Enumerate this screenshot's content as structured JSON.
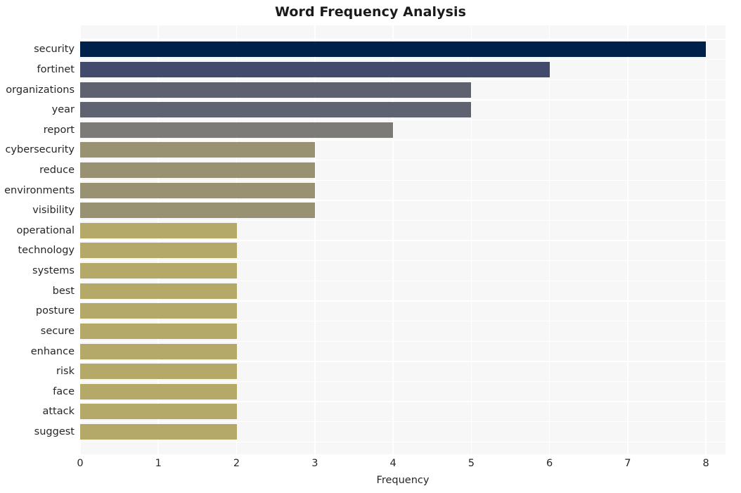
{
  "chart_data": {
    "type": "bar",
    "orientation": "horizontal",
    "title": "Word Frequency Analysis",
    "xlabel": "Frequency",
    "ylabel": "",
    "xlim": [
      0,
      8.25
    ],
    "xticks": [
      0,
      1,
      2,
      3,
      4,
      5,
      6,
      7,
      8
    ],
    "xtick_labels": [
      "0",
      "1",
      "2",
      "3",
      "4",
      "5",
      "6",
      "7",
      "8"
    ],
    "grid": true,
    "legend": null,
    "categories": [
      "security",
      "fortinet",
      "organizations",
      "year",
      "report",
      "cybersecurity",
      "reduce",
      "environments",
      "visibility",
      "operational",
      "technology",
      "systems",
      "best",
      "posture",
      "secure",
      "enhance",
      "risk",
      "face",
      "attack",
      "suggest"
    ],
    "values": [
      8,
      6,
      5,
      5,
      4,
      3,
      3,
      3,
      3,
      2,
      2,
      2,
      2,
      2,
      2,
      2,
      2,
      2,
      2,
      2
    ],
    "bar_colors": [
      "#00214a",
      "#424b6b",
      "#5d6170",
      "#5f6270",
      "#7d7b78",
      "#989172",
      "#989172",
      "#989172",
      "#989172",
      "#b5a96a",
      "#b5a96a",
      "#b5a96a",
      "#b5a96a",
      "#b5a96a",
      "#b5a96a",
      "#b5a96a",
      "#b5a96a",
      "#b5a96a",
      "#b5a96a",
      "#b5a96a"
    ],
    "plot_background": "#f7f7f7",
    "grid_color": "#ffffff",
    "figure_background": "#ffffff",
    "text_color": "#262626"
  }
}
